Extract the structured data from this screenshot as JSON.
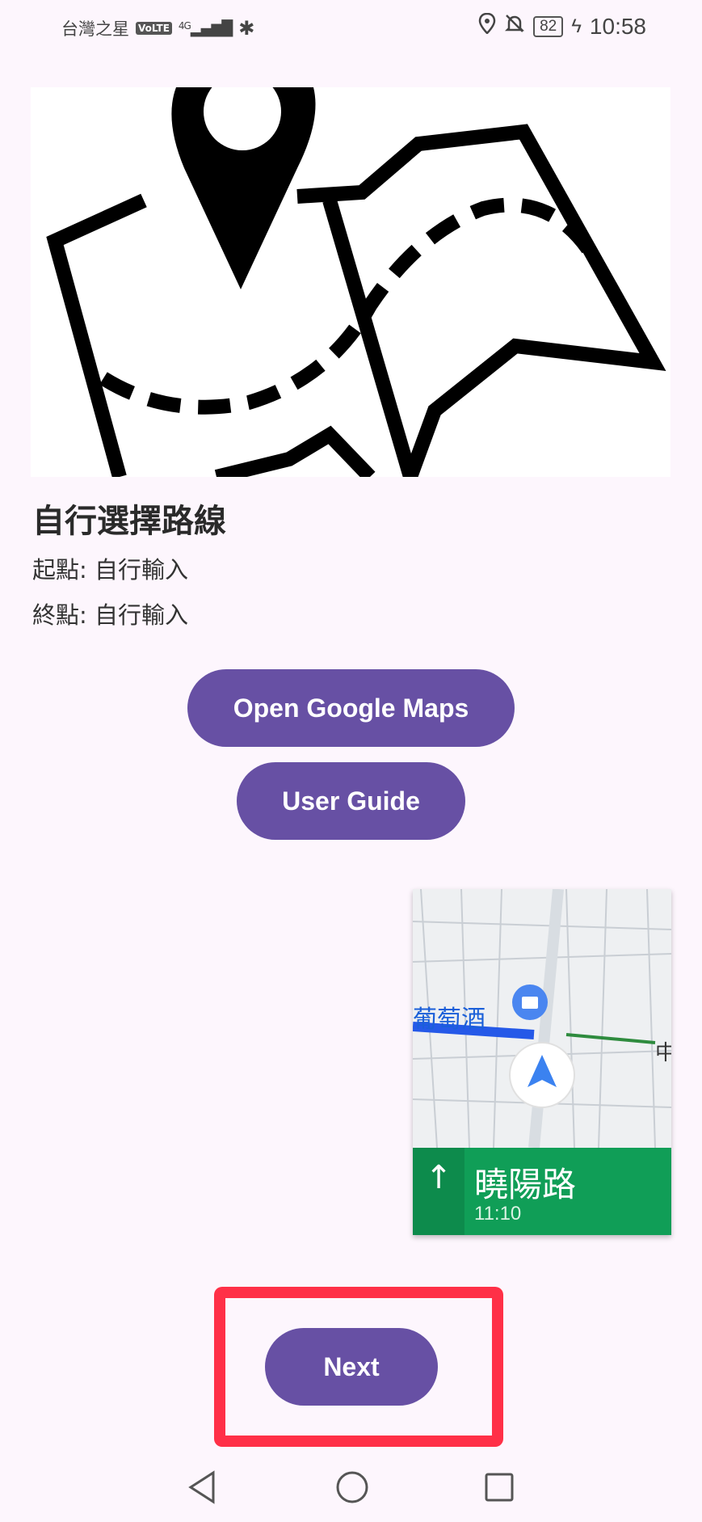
{
  "status_bar": {
    "carrier": "台灣之星",
    "volte": "VoLTE",
    "network": "4G",
    "battery": "82",
    "time": "10:58"
  },
  "route": {
    "title": "自行選擇路線",
    "start": "起點: 自行輸入",
    "end": "終點: 自行輸入"
  },
  "buttons": {
    "open_maps": "Open Google Maps",
    "user_guide": "User Guide",
    "next": "Next"
  },
  "nav_preview": {
    "street": "曉陽路",
    "time": "11:10",
    "place_label": "葡萄酒",
    "side_label": "中"
  },
  "colors": {
    "primary": "#6750a4",
    "background": "#fdf6fd",
    "highlight": "#ff3047",
    "nav_green": "#109e57"
  },
  "icons": {
    "status_right": [
      "location-icon",
      "bell-off-icon",
      "battery-icon",
      "charging-icon"
    ],
    "navbar": [
      "back-icon",
      "home-icon",
      "recents-icon"
    ]
  }
}
